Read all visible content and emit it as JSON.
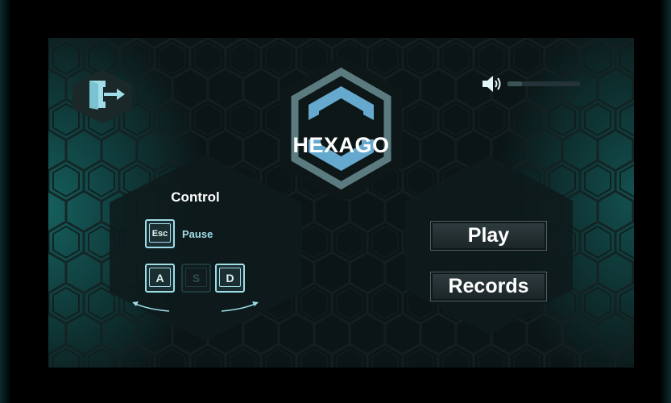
{
  "game": {
    "logo_text": "HEXAGO"
  },
  "controls": {
    "title": "Control",
    "pause_key": "Esc",
    "pause_label": "Pause",
    "move_keys": [
      {
        "label": "A",
        "active": true
      },
      {
        "label": "S",
        "active": false
      },
      {
        "label": "D",
        "active": true
      }
    ]
  },
  "menu": {
    "play_label": "Play",
    "records_label": "Records"
  },
  "icons": {
    "exit": "exit-door-icon",
    "volume": "speaker-icon"
  },
  "colors": {
    "accent": "#9fdde8",
    "logo_accent": "#66a9cf",
    "background": "#0b1516",
    "glow": "#187876"
  }
}
